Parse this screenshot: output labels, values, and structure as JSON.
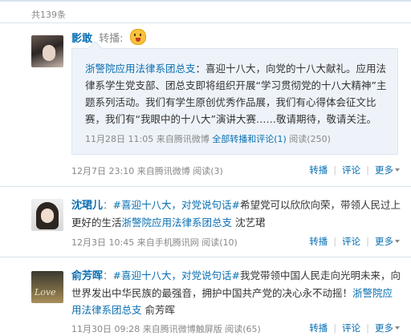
{
  "feed": {
    "count_label": "共139条",
    "items": [
      {
        "author": "影敢",
        "action": "转播:",
        "emoji": "tongue-out-emoji",
        "quote": {
          "author": "浙警院应用法律系团总支",
          "text": "：喜迎十八大，向党的十八大献礼。应用法律系学生党支部、团总支即将组织开展“学习贯彻党的十八大精神”主题系列活动。我们有学生原创优秀作品展，我们有心得体会征文比赛，我们有“我眼中的十八大”演讲大赛……敬请期待，敬请关注。",
          "date": "11月28日",
          "time": "11:05",
          "source": "来自腾讯微博",
          "all_reposts_label": "全部转播和评论(1)",
          "reads": "阅读(250)"
        },
        "date": "12月7日",
        "time": "23:10",
        "source": "来自腾讯微博",
        "reads": "阅读(3)",
        "repost_label": "转播",
        "comment_label": "评论",
        "more_label": "更多"
      },
      {
        "author": "沈珺儿",
        "topic": "#喜迎十八大，对党说句话#",
        "text_a": "希望党可以欣欣向荣，带领人民过上更好的生活",
        "mention": "浙警院应用法律系团总支",
        "text_b": " 沈艺珺",
        "date": "12月3日",
        "time": "10:45",
        "source": "来自手机腾讯网",
        "reads": "阅读(10)",
        "repost_label": "转播",
        "comment_label": "评论",
        "more_label": "更多"
      },
      {
        "author": "俞芳晖",
        "topic": "#喜迎十八大，对党说句话#",
        "text_a": "我党带领中国人民走向光明未来，向世界发出中华民族的最强音，拥护中国共产党的决心永不动摇！",
        "mention": "浙警院应用法律系团总支",
        "text_b": " 俞芳晖",
        "date": "11月30日",
        "time": "09:28",
        "source": "来自腾讯微博触屏版",
        "reads": "阅读(65)",
        "repost_label": "转播",
        "comment_label": "评论",
        "more_label": "更多"
      }
    ]
  }
}
